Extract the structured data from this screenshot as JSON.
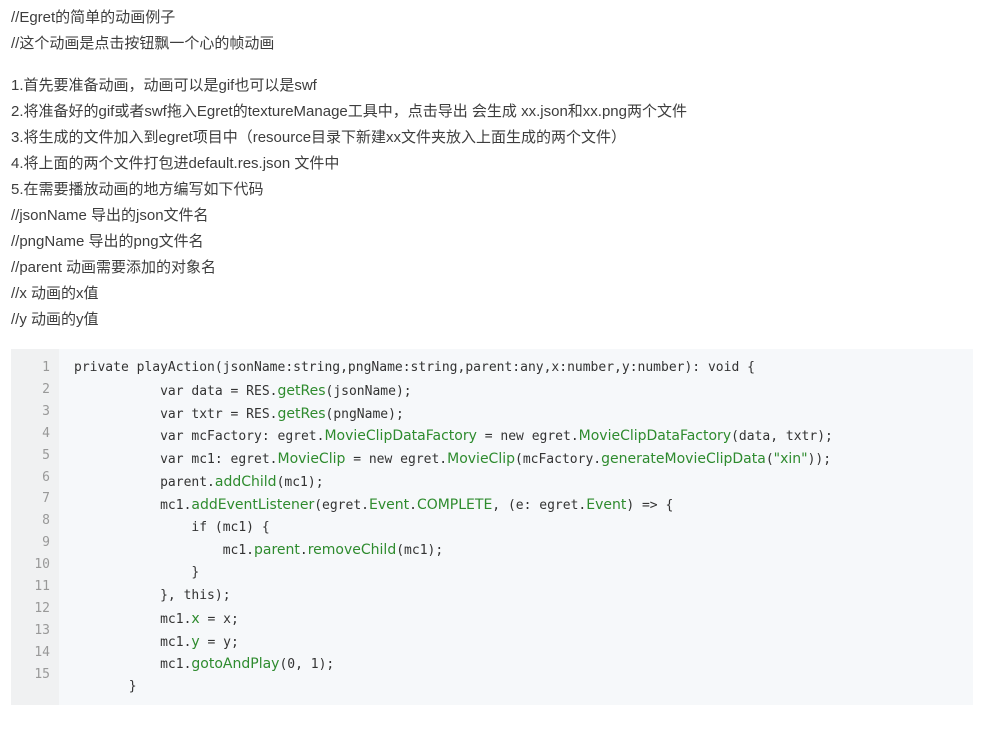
{
  "intro": [
    "//Egret的简单的动画例子",
    "//这个动画是点击按钮飘一个心的帧动画"
  ],
  "steps": [
    "1.首先要准备动画，动画可以是gif也可以是swf",
    "2.将准备好的gif或者swf拖入Egret的textureManage工具中，点击导出 会生成 xx.json和xx.png两个文件",
    "3.将生成的文件加入到egret项目中（resource目录下新建xx文件夹放入上面生成的两个文件）",
    "4.将上面的两个文件打包进default.res.json 文件中",
    "5.在需要播放动画的地方编写如下代码",
    "//jsonName 导出的json文件名",
    "//pngName 导出的png文件名",
    "//parent 动画需要添加的对象名",
    "//x 动画的x值",
    "//y 动画的y值"
  ],
  "code": {
    "line_numbers": [
      "1",
      "2",
      "3",
      "4",
      "5",
      "6",
      "7",
      "8",
      "9",
      "10",
      "11",
      "12",
      "13",
      "14",
      "15"
    ],
    "lines": [
      [
        {
          "t": "private playAction(jsonName:string,pngName:string,parent:any,x:number,y:number): void {"
        }
      ],
      [
        {
          "t": "           var data = RES."
        },
        {
          "t": "getRes",
          "k": "fn"
        },
        {
          "t": "(jsonName);"
        }
      ],
      [
        {
          "t": "           var txtr = RES."
        },
        {
          "t": "getRes",
          "k": "fn"
        },
        {
          "t": "(pngName);"
        }
      ],
      [
        {
          "t": "           var mcFactory: egret."
        },
        {
          "t": "MovieClipDataFactory",
          "k": "fn"
        },
        {
          "t": " = new egret."
        },
        {
          "t": "MovieClipDataFactory",
          "k": "fn"
        },
        {
          "t": "(data, txtr);"
        }
      ],
      [
        {
          "t": "           var mc1: egret."
        },
        {
          "t": "MovieClip",
          "k": "fn"
        },
        {
          "t": " = new egret."
        },
        {
          "t": "MovieClip",
          "k": "fn"
        },
        {
          "t": "(mcFactory."
        },
        {
          "t": "generateMovieClipData",
          "k": "fn"
        },
        {
          "t": "("
        },
        {
          "t": "\"xin\"",
          "k": "str"
        },
        {
          "t": "));"
        }
      ],
      [
        {
          "t": "           parent."
        },
        {
          "t": "addChild",
          "k": "fn"
        },
        {
          "t": "(mc1);"
        }
      ],
      [
        {
          "t": "           mc1."
        },
        {
          "t": "addEventListener",
          "k": "fn"
        },
        {
          "t": "(egret."
        },
        {
          "t": "Event",
          "k": "fn"
        },
        {
          "t": "."
        },
        {
          "t": "COMPLETE",
          "k": "fn"
        },
        {
          "t": ", (e: egret."
        },
        {
          "t": "Event",
          "k": "fn"
        },
        {
          "t": ") => {"
        }
      ],
      [
        {
          "t": "               if (mc1) {"
        }
      ],
      [
        {
          "t": "                   mc1."
        },
        {
          "t": "parent",
          "k": "fn"
        },
        {
          "t": "."
        },
        {
          "t": "removeChild",
          "k": "fn"
        },
        {
          "t": "(mc1);"
        }
      ],
      [
        {
          "t": "               }"
        }
      ],
      [
        {
          "t": "           }, this);"
        }
      ],
      [
        {
          "t": "           mc1."
        },
        {
          "t": "x",
          "k": "fn"
        },
        {
          "t": " = x;"
        }
      ],
      [
        {
          "t": "           mc1."
        },
        {
          "t": "y",
          "k": "fn"
        },
        {
          "t": " = y;"
        }
      ],
      [
        {
          "t": "           mc1."
        },
        {
          "t": "gotoAndPlay",
          "k": "fn"
        },
        {
          "t": "(0, 1);"
        }
      ],
      [
        {
          "t": "       }"
        }
      ]
    ]
  },
  "colors": {
    "code_background": "#f6f8fa",
    "gutter_background": "#f0f1f2",
    "line_number": "#999999",
    "identifier_highlight": "#2e8b2e"
  }
}
